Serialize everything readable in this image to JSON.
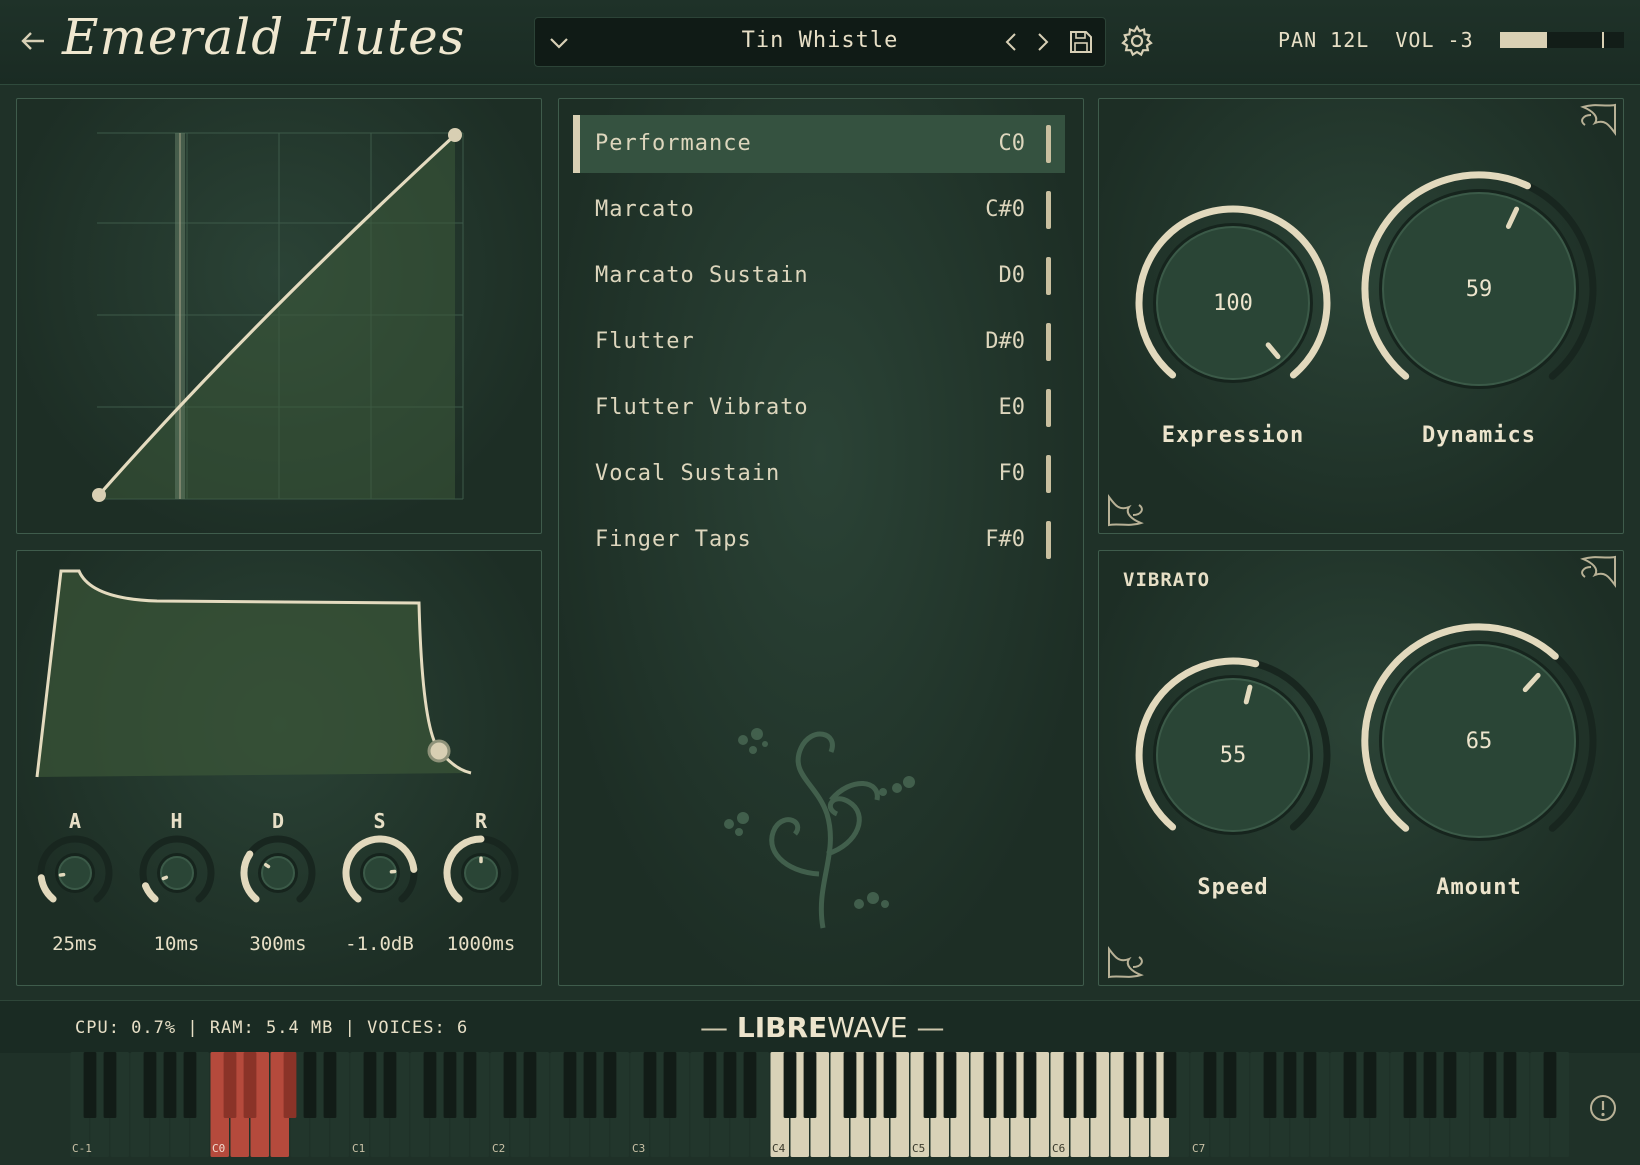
{
  "header": {
    "title": "Emerald Flutes",
    "preset": "Tin Whistle",
    "pan": "PAN 12L",
    "vol": "VOL -3",
    "level": 0.38
  },
  "icons": {
    "back": "back-arrow-icon",
    "dropdown": "chevron-down-icon",
    "prev": "chevron-left-icon",
    "next": "chevron-right-icon",
    "save": "save-icon",
    "settings": "gear-icon",
    "info": "info-icon"
  },
  "envelope": {
    "params": [
      {
        "letter": "A",
        "value": "25ms"
      },
      {
        "letter": "H",
        "value": "10ms"
      },
      {
        "letter": "D",
        "value": "300ms"
      },
      {
        "letter": "S",
        "value": "-1.0dB"
      },
      {
        "letter": "R",
        "value": "1000ms"
      }
    ]
  },
  "articulations": [
    {
      "label": "Performance",
      "key": "C0",
      "selected": true
    },
    {
      "label": "Marcato",
      "key": "C#0",
      "selected": false
    },
    {
      "label": "Marcato Sustain",
      "key": "D0",
      "selected": false
    },
    {
      "label": "Flutter",
      "key": "D#0",
      "selected": false
    },
    {
      "label": "Flutter Vibrato",
      "key": "E0",
      "selected": false
    },
    {
      "label": "Vocal Sustain",
      "key": "F0",
      "selected": false
    },
    {
      "label": "Finger Taps",
      "key": "F#0",
      "selected": false
    }
  ],
  "expression": {
    "label": "Expression",
    "value": "100"
  },
  "dynamics": {
    "label": "Dynamics",
    "value": "59"
  },
  "vibrato": {
    "title": "VIBRATO",
    "speed": {
      "label": "Speed",
      "value": "55"
    },
    "amount": {
      "label": "Amount",
      "value": "65"
    }
  },
  "status": {
    "text": "CPU: 0.7% | RAM: 5.4 MB | VOICES: 6",
    "brand_bold": "LIBRE",
    "brand_light": "WAVE"
  },
  "keyboard": {
    "octave_labels": [
      "C-1",
      "C0",
      "C1",
      "C2",
      "C3",
      "C4",
      "C5",
      "C6",
      "C7"
    ],
    "keyswitch_range": "C0-F#0",
    "playable_range": "C4-B6"
  },
  "colors": {
    "accent": "#e2d9bd",
    "keyswitch": "#b54a3c",
    "panel": "#233a2e"
  }
}
